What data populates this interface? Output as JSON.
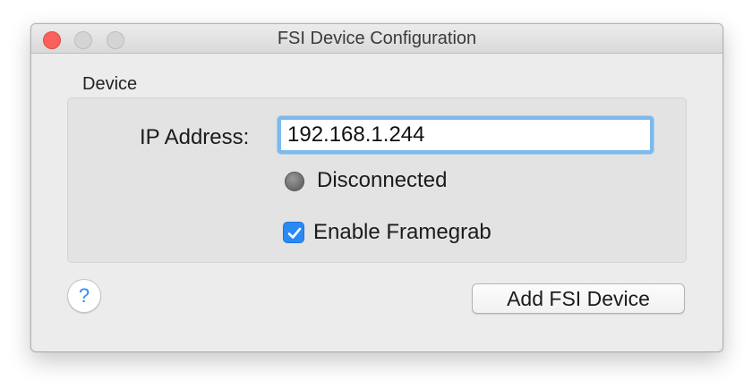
{
  "window": {
    "title": "FSI Device Configuration"
  },
  "device_group": {
    "label": "Device",
    "ip_address_label": "IP Address:",
    "ip_address_value": "192.168.1.244",
    "status_text": "Disconnected",
    "status_color": "#7a7a7a",
    "enable_framegrab_label": "Enable Framegrab",
    "enable_framegrab_checked": true
  },
  "buttons": {
    "help_label": "?",
    "add_device_label": "Add FSI Device"
  },
  "colors": {
    "accent": "#2a8af5",
    "focus_ring": "#7fb9ec",
    "close_button": "#fc605c"
  }
}
